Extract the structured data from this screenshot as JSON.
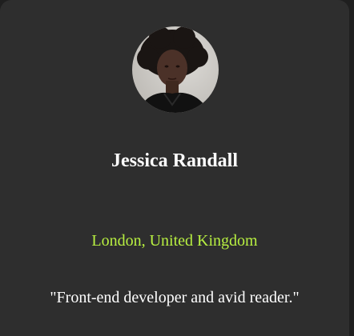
{
  "profile": {
    "name": "Jessica Randall",
    "location": "London, United Kingdom",
    "bio": "\"Front-end developer and avid reader.\"",
    "avatar_icon": "profile-photo"
  },
  "colors": {
    "card_background": "#2e2e2e",
    "location_accent": "#b8f041",
    "text": "#ffffff"
  }
}
